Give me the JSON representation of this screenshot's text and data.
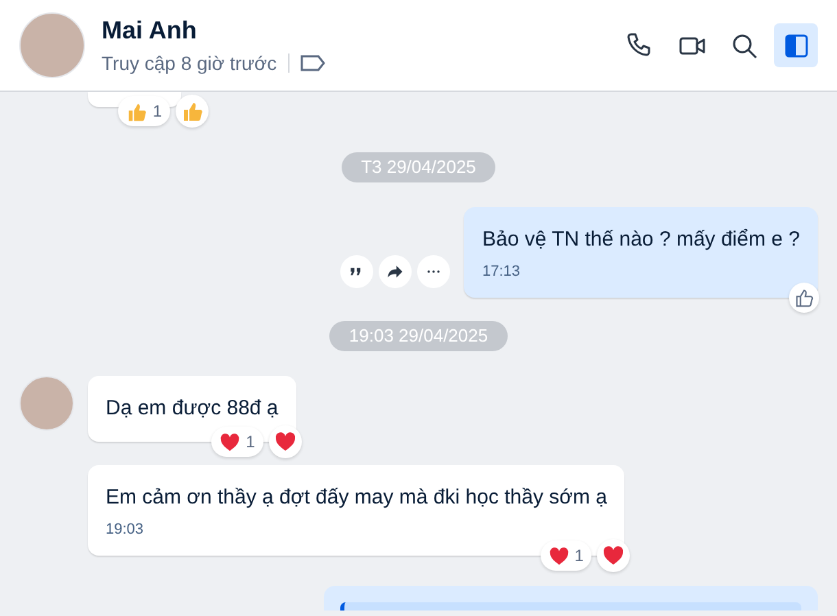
{
  "contact": {
    "name": "Mai Anh",
    "status": "Truy cập 8 giờ trước"
  },
  "header_actions": [
    {
      "kind": "call",
      "selected": false
    },
    {
      "kind": "video",
      "selected": false
    },
    {
      "kind": "search",
      "selected": false
    },
    {
      "kind": "panel",
      "selected": true
    }
  ],
  "feed": [
    {
      "kind": "partial_top",
      "reactions": [
        {
          "kind": "like",
          "count": "1"
        }
      ]
    },
    {
      "kind": "date",
      "text": "T3 29/04/2025"
    },
    {
      "kind": "message",
      "outgoing": true,
      "text": "Bảo vệ TN thế nào ? mấy điểm e ?",
      "time": "17:13",
      "actions": [
        {
          "kind": "quote"
        },
        {
          "kind": "forward"
        },
        {
          "kind": "more"
        }
      ]
    },
    {
      "kind": "date",
      "text": "19:03 29/04/2025"
    },
    {
      "kind": "message",
      "outgoing": false,
      "avatar": true,
      "text": "Dạ em được 88đ ạ",
      "reactions": [
        {
          "kind": "heart",
          "count": "1"
        }
      ]
    },
    {
      "kind": "message",
      "outgoing": false,
      "avatar": false,
      "text": "Em cảm ơn thầy ạ đợt đấy may mà đki học thầy sớm ạ",
      "time": "19:03",
      "reactions": [
        {
          "kind": "heart",
          "count": "1"
        }
      ]
    },
    {
      "kind": "partial_bottom"
    }
  ]
}
